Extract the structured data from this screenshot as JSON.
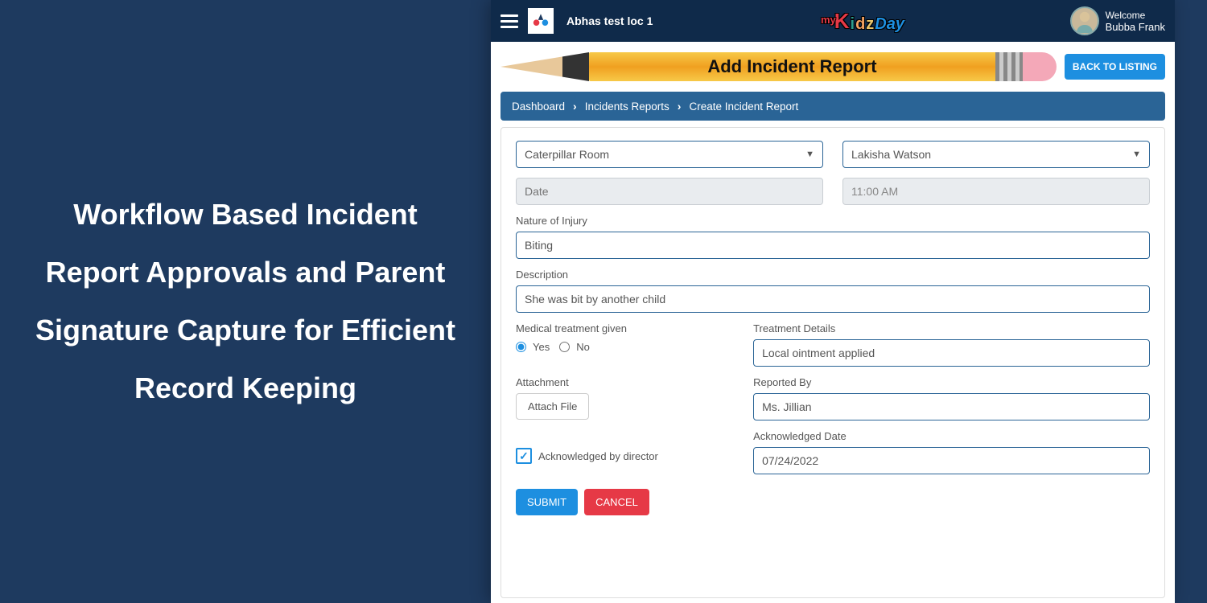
{
  "marketing": {
    "headline": "Workflow Based Incident Report Approvals and Parent Signature Capture for Efficient Record Keeping"
  },
  "header": {
    "location_name": "Abhas test loc 1",
    "brand_my": "my",
    "brand_kidzday": "KidzDay",
    "welcome_label": "Welcome",
    "user_name": "Bubba Frank"
  },
  "banner": {
    "title": "Add Incident Report",
    "back_label": "BACK TO LISTING"
  },
  "breadcrumb": {
    "items": [
      "Dashboard",
      "Incidents Reports",
      "Create Incident Report"
    ]
  },
  "form": {
    "room_select": "Caterpillar Room",
    "child_select": "Lakisha Watson",
    "date_placeholder": "Date",
    "time_value": "11:00 AM",
    "nature_label": "Nature of Injury",
    "nature_value": "Biting",
    "description_label": "Description",
    "description_value": "She was bit by another child",
    "medical_label": "Medical treatment given",
    "medical_yes": "Yes",
    "medical_no": "No",
    "medical_selected": "yes",
    "treatment_label": "Treatment Details",
    "treatment_value": "Local ointment applied",
    "attachment_label": "Attachment",
    "attach_button": "Attach File",
    "reported_label": "Reported By",
    "reported_value": "Ms. Jillian",
    "ack_label": "Acknowledged by director",
    "ack_checked": true,
    "ack_date_label": "Acknowledged Date",
    "ack_date_value": "07/24/2022",
    "submit_label": "SUBMIT",
    "cancel_label": "CANCEL"
  }
}
